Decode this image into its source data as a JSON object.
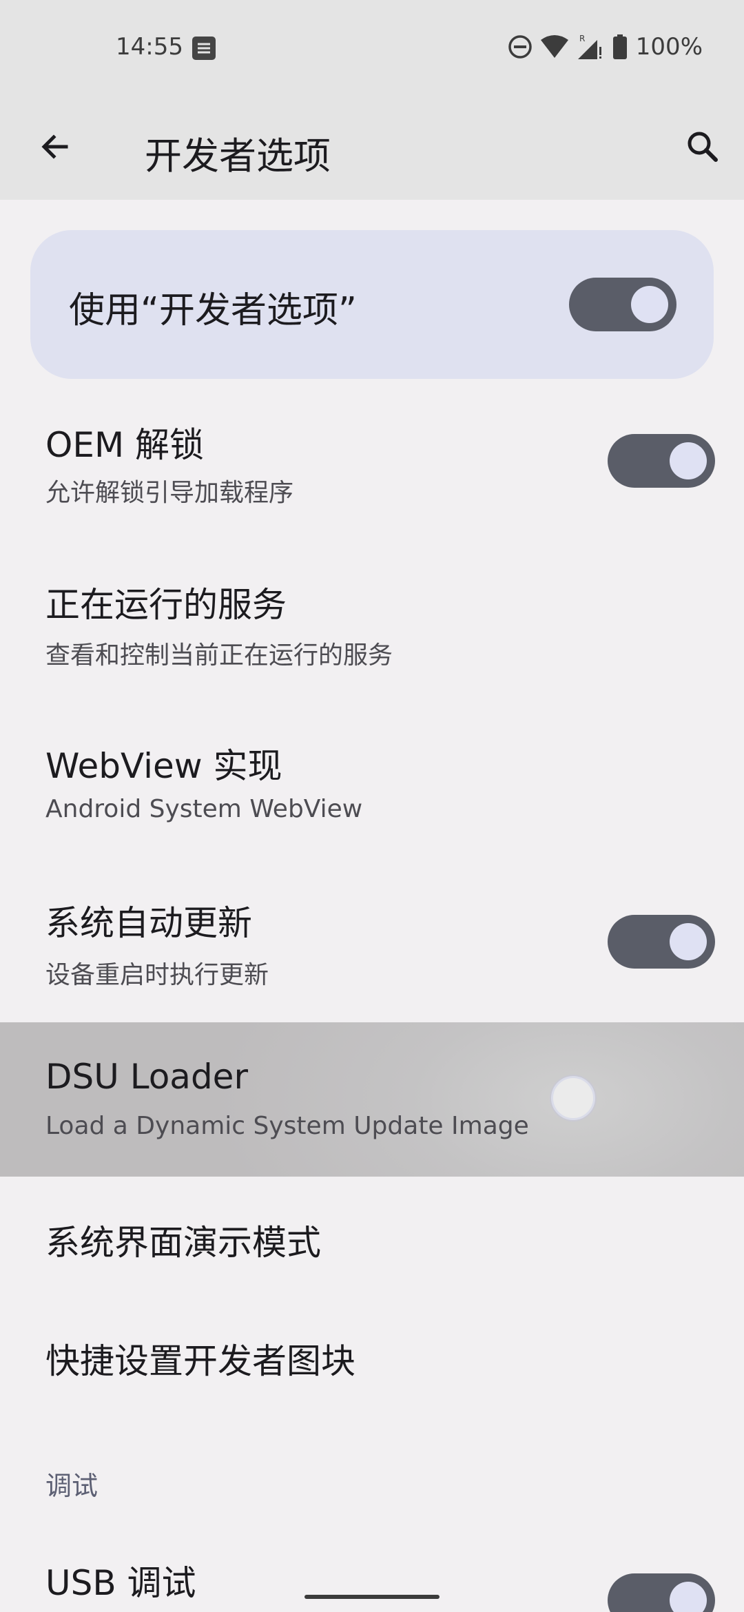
{
  "status_bar": {
    "time": "14:55",
    "battery": "100%",
    "icons": [
      "notification-icon",
      "dnd-icon",
      "wifi-icon",
      "signal-icon",
      "battery-icon"
    ]
  },
  "app_bar": {
    "title": "开发者选项",
    "back_icon": "arrow-back-icon",
    "search_icon": "search-icon"
  },
  "master_toggle": {
    "label": "使用“开发者选项”",
    "checked": true
  },
  "settings": [
    {
      "title": "OEM 解锁",
      "subtitle": "允许解锁引导加载程序",
      "switch": true,
      "checked": true
    },
    {
      "title": "正在运行的服务",
      "subtitle": "查看和控制当前正在运行的服务"
    },
    {
      "title": "WebView 实现",
      "subtitle": "Android System WebView"
    },
    {
      "title": "系统自动更新",
      "subtitle": "设备重启时执行更新",
      "switch": true,
      "checked": true
    },
    {
      "title": "DSU Loader",
      "subtitle": "Load a Dynamic System Update Image",
      "pressed": true
    },
    {
      "title": "系统界面演示模式"
    },
    {
      "title": "快捷设置开发者图块"
    }
  ],
  "section_debug": {
    "header": "调试",
    "items": [
      {
        "title": "USB 调试",
        "switch": true,
        "checked": true
      }
    ]
  },
  "colors": {
    "background": "#f2f0f2",
    "bar": "#e4e4e4",
    "card": "#dfe1f0",
    "switch_track": "#5a5d68",
    "switch_thumb": "#dfe1f3",
    "section_header": "#5c5f73"
  }
}
